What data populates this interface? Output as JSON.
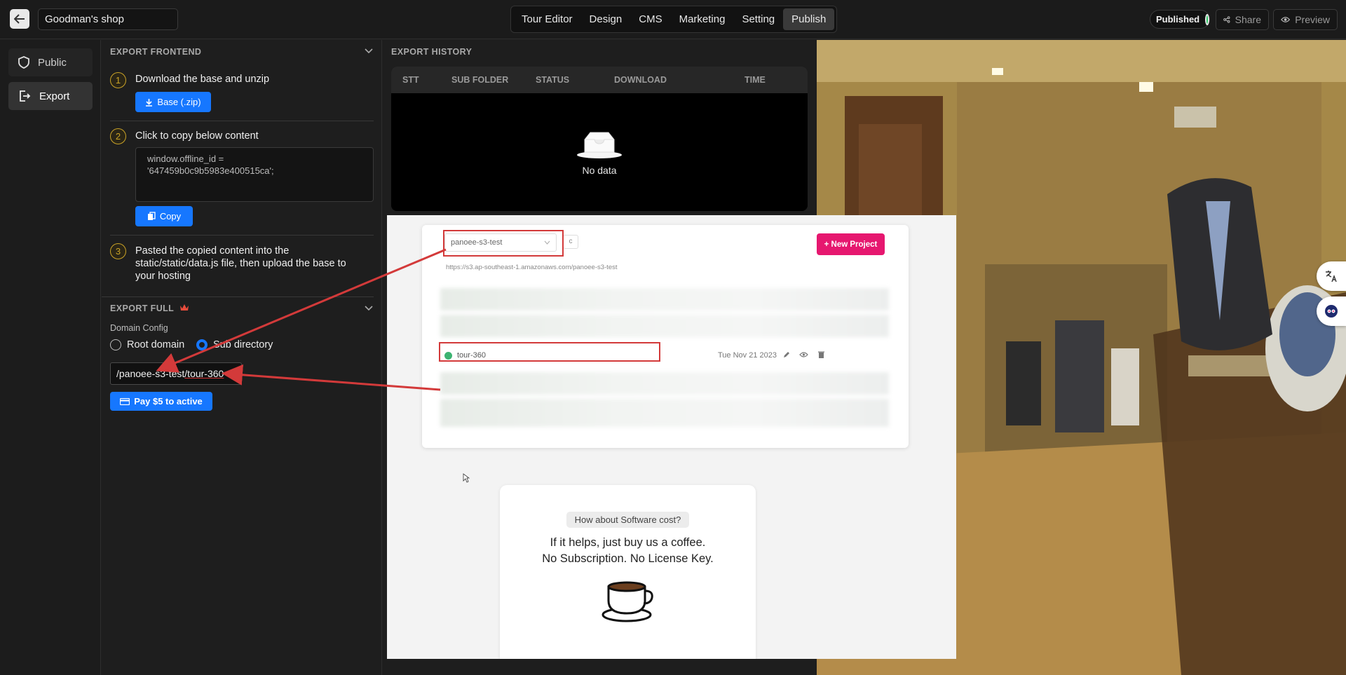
{
  "topbar": {
    "shop_name": "Goodman's shop",
    "nav": [
      "Tour Editor",
      "Design",
      "CMS",
      "Marketing",
      "Setting",
      "Publish"
    ],
    "active_nav": "Publish",
    "published_label": "Published",
    "share_label": "Share",
    "preview_label": "Preview"
  },
  "sidebar": {
    "items": [
      {
        "label": "Public"
      },
      {
        "label": "Export"
      }
    ]
  },
  "export_frontend": {
    "heading": "EXPORT FRONTEND",
    "steps": [
      {
        "num": "1",
        "text": "Download the base and unzip",
        "button": "Base (.zip)"
      },
      {
        "num": "2",
        "text": "Click to copy below content",
        "button": "Copy"
      },
      {
        "num": "3",
        "text": "Pasted the copied content into the static/static/data.js file, then upload the base to your hosting"
      }
    ],
    "code_line1": "window.offline_id =",
    "code_line2": "'647459b0c9b5983e400515ca';"
  },
  "export_full": {
    "heading": "EXPORT FULL",
    "domain_config_label": "Domain Config",
    "radio_root": "Root domain",
    "radio_sub": "Sub directory",
    "path_part1": "/panoee-s3-test",
    "path_part2": "/tour-360",
    "pay_button": "Pay $5 to active"
  },
  "history": {
    "heading": "EXPORT HISTORY",
    "columns": [
      "STT",
      "SUB FOLDER",
      "STATUS",
      "DOWNLOAD",
      "TIME"
    ],
    "empty_text": "No data"
  },
  "overlay": {
    "bucket_select": "panoee-s3-test",
    "small_btn": "c",
    "new_project": "+ New Project",
    "bucket_url": "https://s3.ap-southeast-1.amazonaws.com/panoee-s3-test",
    "tour_name": "tour-360",
    "tour_date": "Tue Nov 21 2023",
    "coffee_pill": "How about Software cost?",
    "coffee_line1": "If it helps, just buy us a coffee.",
    "coffee_line2": "No Subscription. No License Key."
  },
  "colors": {
    "accent_blue": "#1677ff",
    "publish_green": "#22c55e",
    "pink": "#e6176f",
    "annotation_red": "#d33a3a"
  }
}
